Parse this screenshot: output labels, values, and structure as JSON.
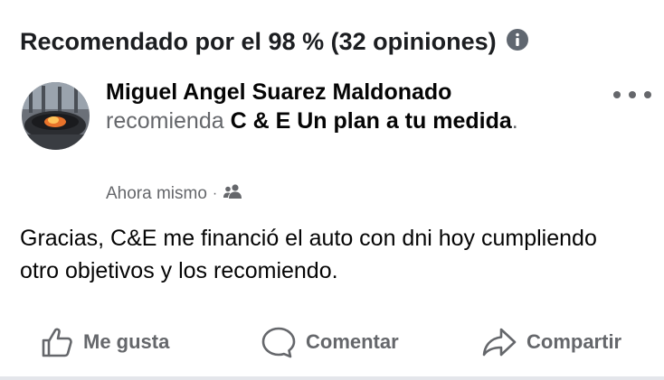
{
  "header": {
    "title": "Recomendado por el 98 % (32 opiniones)",
    "info_icon": "info-icon"
  },
  "post": {
    "author": "Miguel Angel Suarez Maldonado",
    "verb": "recomienda",
    "page_name": "C & E Un plan a tu medida",
    "period": ".",
    "timestamp": "Ahora mismo",
    "separator": "·",
    "audience_icon": "friends-icon",
    "body": "Gracias, C&E me financió el auto con dni hoy cumpliendo otro objetivos y los recomiendo."
  },
  "actions": {
    "like_label": "Me gusta",
    "comment_label": "Comentar",
    "share_label": "Compartir"
  },
  "colors": {
    "secondary_text": "#65676b",
    "primary_text": "#050505",
    "divider": "#e4e6eb"
  }
}
